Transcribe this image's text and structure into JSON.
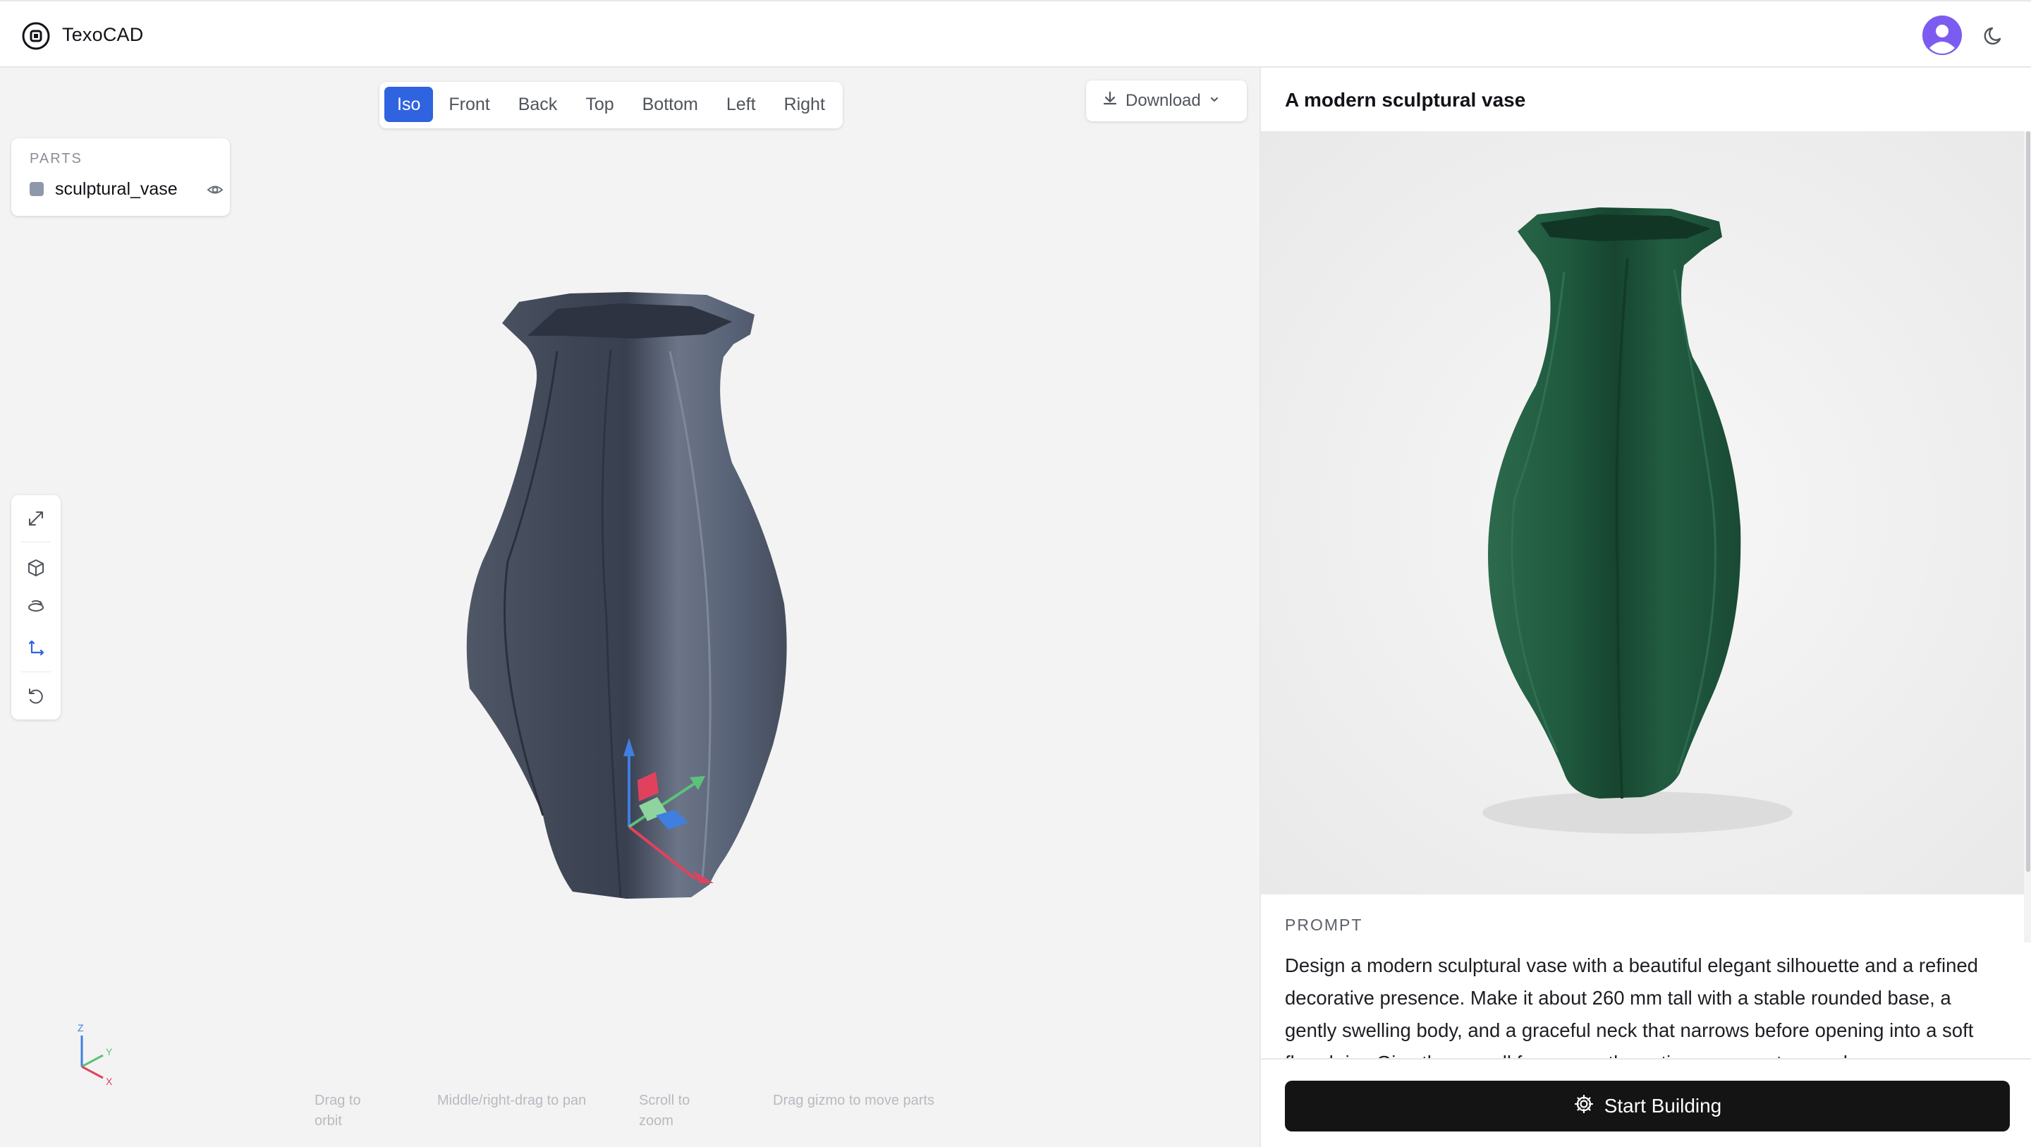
{
  "app": {
    "title": "TexoCAD",
    "logo_icon": "texocad-logo-icon",
    "avatar_color": "#7c5cf0"
  },
  "view_tabs": {
    "active": "Iso",
    "items": [
      "Iso",
      "Front",
      "Back",
      "Top",
      "Bottom",
      "Left",
      "Right"
    ]
  },
  "download": {
    "label": "Download"
  },
  "parts": {
    "heading": "PARTS",
    "items": [
      {
        "name": "sculptural_vase",
        "color": "#8f97ab",
        "visible": true
      }
    ]
  },
  "toolbar": {
    "tools": [
      "expand-icon",
      "cube-icon",
      "orbit-icon",
      "axes-icon",
      "reset-icon"
    ],
    "active_tool": "axes-icon"
  },
  "axes": {
    "x": "X",
    "y": "Y",
    "z": "Z"
  },
  "hints": {
    "orbit": "Drag to orbit",
    "pan": "Middle/right-drag to pan",
    "zoom": "Scroll to zoom",
    "move": "Drag gizmo to move parts"
  },
  "model": {
    "title": "A modern sculptural vase",
    "reference_color": "#1f5a3f",
    "viewport_color": "#4a5262"
  },
  "prompt": {
    "label": "PROMPT",
    "text": "Design a modern sculptural vase with a beautiful elegant silhouette and a refined decorative presence. Make it about 260 mm tall with a stable rounded base, a gently swelling body, and a graceful neck that narrows before opening into a soft flared rim. Give the overall form smooth continuous curvature and"
  },
  "actions": {
    "start_building": "Start Building"
  },
  "colors": {
    "accent": "#2f63df",
    "build_button": "#141414",
    "viewport_bg": "#f3f3f3"
  }
}
